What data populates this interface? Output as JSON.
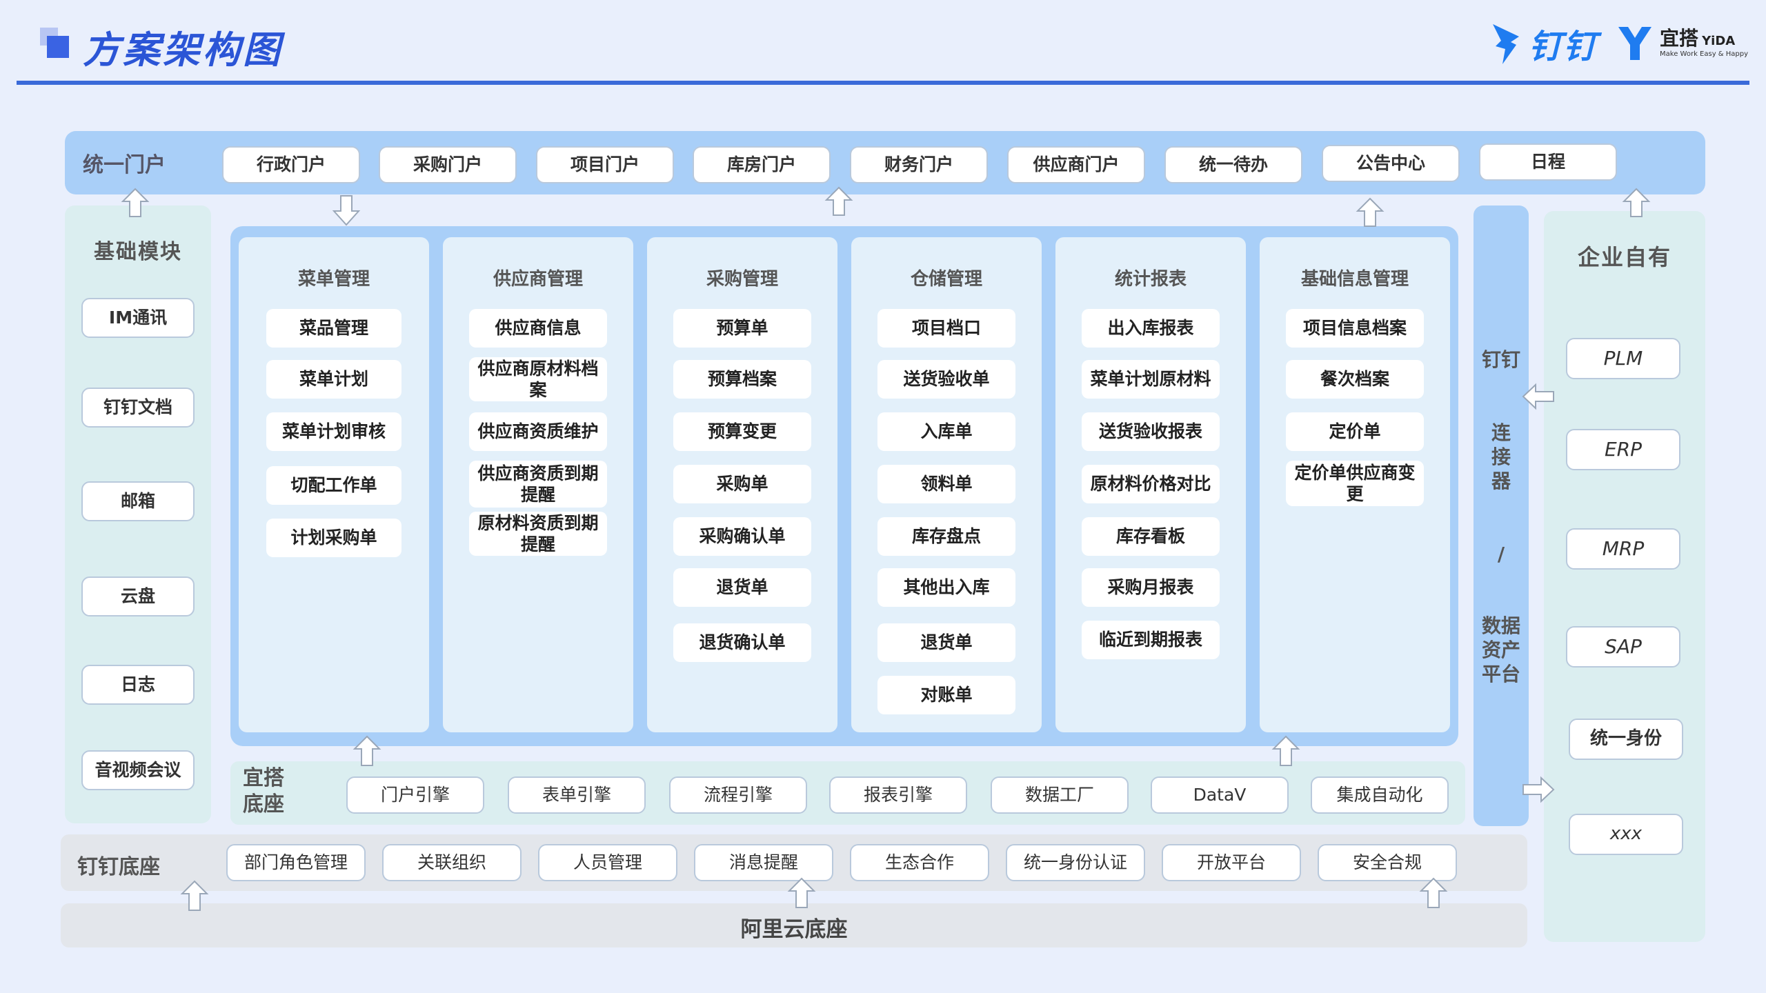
{
  "header": {
    "title": "方案架构图",
    "brand_dingtalk": "钉钉",
    "brand_yida_cn": "宜搭",
    "brand_yida_en": "YiDA",
    "brand_yida_slogan": "Make Work Easy & Happy"
  },
  "portal": {
    "label": "统一门户",
    "items": [
      "行政门户",
      "采购门户",
      "项目门户",
      "库房门户",
      "财务门户",
      "供应商门户",
      "统一待办",
      "公告中心",
      "日程"
    ]
  },
  "base_modules": {
    "label": "基础模块",
    "items": [
      "IM通讯",
      "钉钉文档",
      "邮箱",
      "云盘",
      "日志",
      "音视频会议"
    ]
  },
  "modules": [
    {
      "title": "菜单管理",
      "items": [
        "菜品管理",
        "菜单计划",
        "菜单计划审核",
        "切配工作单",
        "计划采购单"
      ]
    },
    {
      "title": "供应商管理",
      "items": [
        "供应商信息",
        "供应商原材料档案",
        "供应商资质维护",
        "供应商资质到期提醒",
        "原材料资质到期提醒"
      ]
    },
    {
      "title": "采购管理",
      "items": [
        "预算单",
        "预算档案",
        "预算变更",
        "采购单",
        "采购确认单",
        "退货单",
        "退货确认单"
      ]
    },
    {
      "title": "仓储管理",
      "items": [
        "项目档口",
        "送货验收单",
        "入库单",
        "领料单",
        "库存盘点",
        "其他出入库",
        "退货单",
        "对账单"
      ]
    },
    {
      "title": "统计报表",
      "items": [
        "出入库报表",
        "菜单计划原材料",
        "送货验收报表",
        "原材料价格对比",
        "库存看板",
        "采购月报表",
        "临近到期报表"
      ]
    },
    {
      "title": "基础信息管理",
      "items": [
        "项目信息档案",
        "餐次档案",
        "定价单",
        "定价单供应商变更"
      ]
    }
  ],
  "connector": {
    "line1": "钉钉",
    "line2": "连接器",
    "line3": "/",
    "line4": "数据资产平台"
  },
  "enterprise": {
    "label": "企业自有",
    "items": [
      "PLM",
      "ERP",
      "MRP",
      "SAP",
      "统一身份",
      "xxx"
    ]
  },
  "yida_base": {
    "label": "宜搭底座",
    "items": [
      "门户引擎",
      "表单引擎",
      "流程引擎",
      "报表引擎",
      "数据工厂",
      "DataV",
      "集成自动化"
    ]
  },
  "dingtalk_base": {
    "label": "钉钉底座",
    "items": [
      "部门角色管理",
      "关联组织",
      "人员管理",
      "消息提醒",
      "生态合作",
      "统一身份认证",
      "开放平台",
      "安全合规"
    ]
  },
  "aliyun_base": {
    "label": "阿里云底座"
  },
  "colors": {
    "accent": "#2b55d6",
    "panel_blue": "#a9cff8",
    "panel_green": "#dbeef0",
    "panel_gray": "#e3e6eb"
  }
}
